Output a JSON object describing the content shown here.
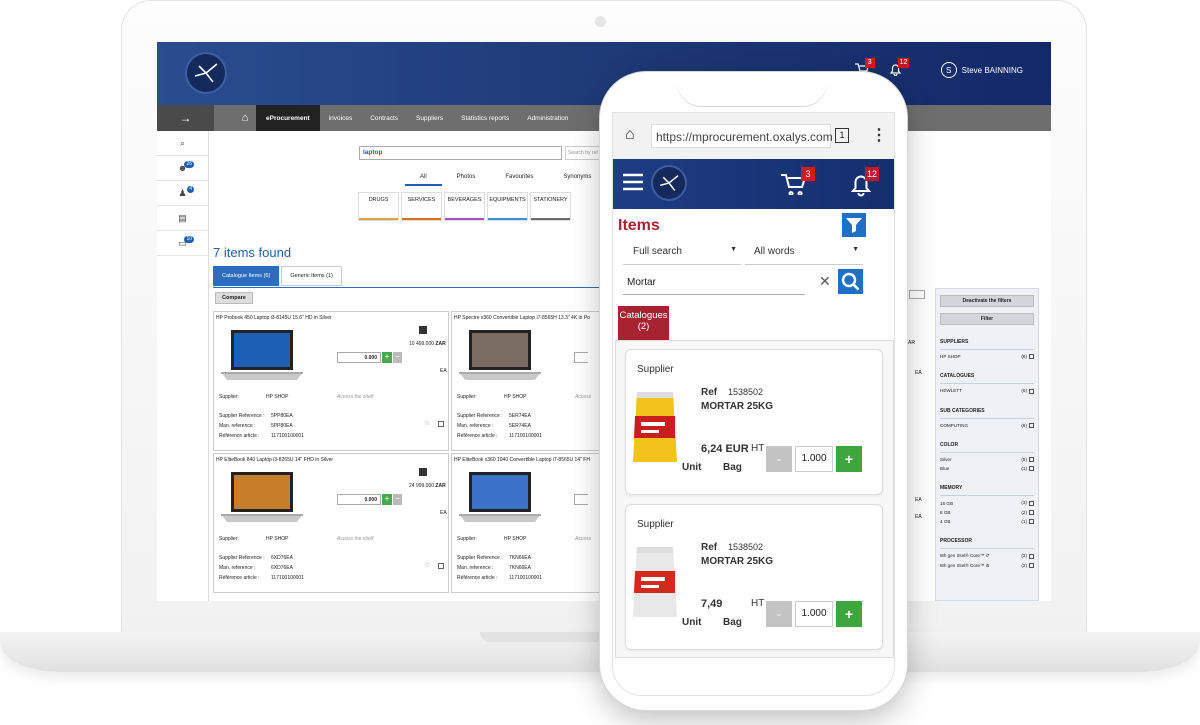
{
  "desktop": {
    "header": {
      "cart_badge": "3",
      "bell_badge": "12",
      "user_initial": "S",
      "user_name": "Steve BAINNING"
    },
    "nav": {
      "items": [
        "eProcurement",
        "invoices",
        "Contracts",
        "Suppliers",
        "Statistics reports",
        "Administration"
      ]
    },
    "rail": {
      "badges": [
        "26",
        "4",
        "10"
      ]
    },
    "search": {
      "query": "laptop",
      "placeholder": "Search by ref"
    },
    "filter_tabs": [
      "All",
      "Photos",
      "Favourites",
      "Synonyms"
    ],
    "categories": [
      "DRUGS",
      "SERVICES",
      "BEVERAGES",
      "EQUIPMENTS",
      "STATIONERY"
    ],
    "category_colors": [
      "#d9a441",
      "#e06c1f",
      "#a94fc2",
      "#3c8fd9",
      "#6b6b6b"
    ],
    "results": {
      "count_text": "7 items found",
      "tab_catalogue": "Catalogue Items (6)",
      "tab_generic": "Generic Items (1)",
      "compare": "Compare"
    },
    "cards": [
      {
        "title": "HP Probook 450 Laptop i3-8145U 15.6\" HD in Silver",
        "qty": "0.000",
        "price": "10 499.000",
        "currency": "ZAR",
        "unit": "EA",
        "shelf": "Access the shelf",
        "supplier_label": "Supplier:",
        "supplier": "HP SHOP",
        "supplier_ref_label": "Supplier Reference :",
        "supplier_ref": "5PP80EA",
        "man_ref_label": "Man. reference :",
        "man_ref": "5PP80EA",
        "article_label": "Référence article :",
        "article": "117100100001"
      },
      {
        "title": "HP Spectre x360 Convertible Laptop i7-8565H 13.3\" 4K in Po",
        "qty": "",
        "price": "",
        "currency": "",
        "unit": "",
        "shelf": "Access",
        "supplier_label": "Supplier:",
        "supplier": "HP SHOP",
        "supplier_ref_label": "Supplier Reference :",
        "supplier_ref": "5ER74EA",
        "man_ref_label": "Man. reference :",
        "man_ref": "5ER74EA",
        "article_label": "Référence article :",
        "article": "117100100001"
      },
      {
        "title": "HP EliteBook 840 Laptop i3-8265U 14\" FHD in Silver",
        "qty": "0.000",
        "price": "24 999.000",
        "currency": "ZAR",
        "unit": "EA",
        "shelf": "Access the shelf",
        "supplier_label": "Supplier:",
        "supplier": "HP SHOP",
        "supplier_ref_label": "Supplier Reference :",
        "supplier_ref": "6XD76EA",
        "man_ref_label": "Man. reference :",
        "man_ref": "6XD76EA",
        "article_label": "Référence article :",
        "article": "117100100001"
      },
      {
        "title": "HP EliteBook x360 1040 Convertible Laptop i7-8565U 14\" FH",
        "qty": "",
        "price": "",
        "currency": "",
        "unit": "",
        "shelf": "Access",
        "supplier_label": "Supplier:",
        "supplier": "HP SHOP",
        "supplier_ref_label": "Supplier Reference :",
        "supplier_ref": "7KN66EA",
        "man_ref_label": "Man. reference :",
        "man_ref": "7KN66EA",
        "article_label": "Référence article :",
        "article": "117100100001"
      }
    ],
    "right_col": {
      "units": [
        "EA",
        "EA",
        "EA"
      ]
    },
    "filters": {
      "deactivate": "Deactivate the filters",
      "filter": "Filter",
      "sections": [
        {
          "title": "SUPPLIERS",
          "rows": [
            {
              "label": "HP SHOP",
              "count": "(6)"
            }
          ]
        },
        {
          "title": "CATALOGUES",
          "rows": [
            {
              "label": "HEWLETT",
              "count": "(6)"
            }
          ]
        },
        {
          "title": "SUB CATEGORIES",
          "rows": [
            {
              "label": "COMPUTING",
              "count": "(6)"
            }
          ]
        },
        {
          "title": "COLOR",
          "rows": [
            {
              "label": "Silver",
              "count": "(5)"
            },
            {
              "label": "Blue",
              "count": "(1)"
            }
          ]
        },
        {
          "title": "MEMORY",
          "rows": [
            {
              "label": "16 GB",
              "count": "(3)"
            },
            {
              "label": "8 GB",
              "count": "(2)"
            },
            {
              "label": "4 GB",
              "count": "(1)"
            }
          ]
        },
        {
          "title": "PROCESSOR",
          "rows": [
            {
              "label": "8th gen Intel® Core™ i7",
              "count": "(3)"
            },
            {
              "label": "8th gen Intel® Core™ i5",
              "count": "(2)"
            }
          ]
        }
      ]
    }
  },
  "mobile": {
    "url": "https://mprocurement.oxalys.com",
    "tab_count": "1",
    "cart_badge": "3",
    "bell_badge": "12",
    "title": "Items",
    "search_mode": "Full search",
    "word_mode": "All words",
    "query": "Mortar",
    "catalogues_tab": "Catalogues",
    "catalogues_count": "(2)",
    "items": [
      {
        "supplier": "Supplier",
        "ref_label": "Ref",
        "ref": "1538502",
        "name": "MORTAR 25KG",
        "price": "6,24 EUR",
        "ht": "HT",
        "unit_label": "Unit",
        "unit": "Bag",
        "qty": "1.000",
        "minus": "-",
        "plus": "+"
      },
      {
        "supplier": "Supplier",
        "ref_label": "Ref",
        "ref": "1538502",
        "name": "MORTAR 25KG",
        "price": "7,49",
        "ht": "HT",
        "unit_label": "Unit",
        "unit": "Bag",
        "qty": "1.000",
        "minus": "-",
        "plus": "+"
      }
    ]
  }
}
